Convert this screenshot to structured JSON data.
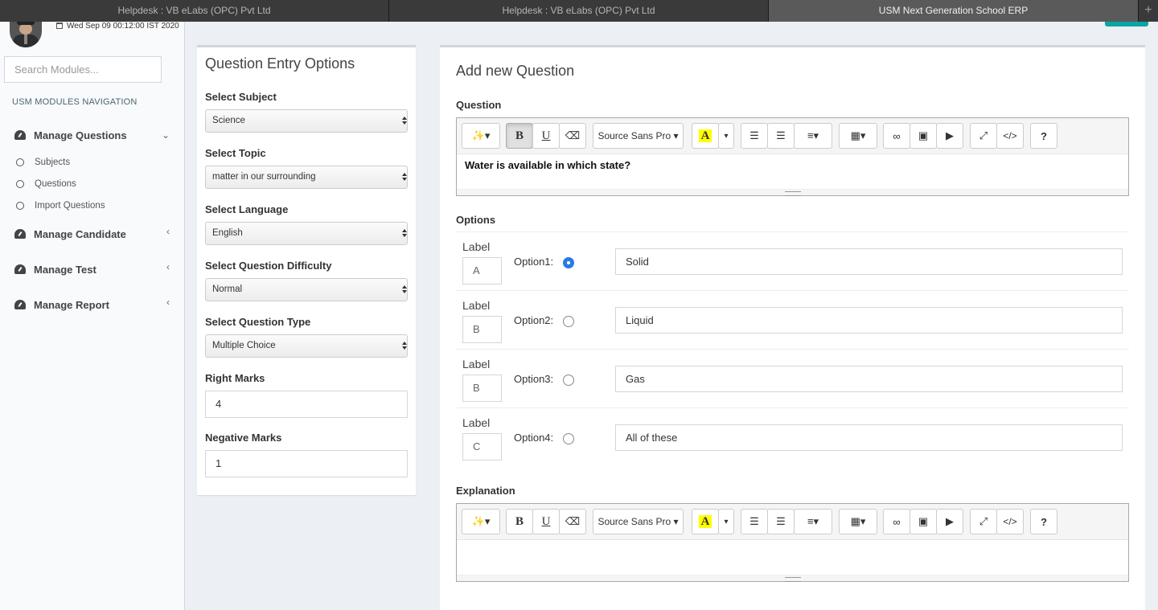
{
  "browser_tabs": [
    {
      "title": "Helpdesk : VB eLabs (OPC) Pvt Ltd",
      "active": false
    },
    {
      "title": "Helpdesk : VB eLabs (OPC) Pvt Ltd",
      "active": false
    },
    {
      "title": "USM Next Generation School ERP",
      "active": true
    }
  ],
  "new_tab_icon": "plus-icon",
  "user": {
    "date": "Wed Sep 09 00:12:00 IST 2020"
  },
  "sidebar": {
    "search_placeholder": "Search Modules...",
    "nav_header": "USM MODULES NAVIGATION",
    "menu": [
      {
        "label": "Manage Questions",
        "icon": "dashboard-icon",
        "expanded": true,
        "children": [
          "Subjects",
          "Questions",
          "Import Questions"
        ]
      },
      {
        "label": "Manage Candidate",
        "icon": "dashboard-icon",
        "expanded": false
      },
      {
        "label": "Manage Test",
        "icon": "dashboard-icon",
        "expanded": false
      },
      {
        "label": "Manage Report",
        "icon": "dashboard-icon",
        "expanded": false
      }
    ]
  },
  "entry_options": {
    "title": "Question Entry Options",
    "subject": {
      "label": "Select Subject",
      "value": "Science"
    },
    "topic": {
      "label": "Select Topic",
      "value": "matter in our surrounding"
    },
    "language": {
      "label": "Select Language",
      "value": "English"
    },
    "difficulty": {
      "label": "Select Question Difficulty",
      "value": "Normal"
    },
    "type": {
      "label": "Select Question Type",
      "value": "Multiple Choice"
    },
    "right_marks": {
      "label": "Right Marks",
      "value": "4"
    },
    "negative_marks": {
      "label": "Negative Marks",
      "value": "1"
    }
  },
  "question_form": {
    "title": "Add new Question",
    "question_label": "Question",
    "question_text": "Water is available in which state?",
    "options_label": "Options",
    "explanation_label": "Explanation",
    "editor_font": "Source Sans Pro",
    "options": [
      {
        "label_caption": "Label",
        "label": "A",
        "name": "Option1:",
        "value": "Solid",
        "selected": true
      },
      {
        "label_caption": "Label",
        "label": "B",
        "name": "Option2:",
        "value": "Liquid",
        "selected": false
      },
      {
        "label_caption": "Label",
        "label": "B",
        "name": "Option3:",
        "value": "Gas",
        "selected": false
      },
      {
        "label_caption": "Label",
        "label": "C",
        "name": "Option4:",
        "value": "All of these",
        "selected": false
      }
    ]
  },
  "toolbar_glyphs": {
    "bold": "B",
    "underline": "U",
    "highlight": "A",
    "code": "</>",
    "help": "?"
  },
  "colors": {
    "accent": "#2a7ae2",
    "teal_button": "#0aa5a4",
    "sidebar_bg": "#f9fafc",
    "content_bg": "#ecf0f5"
  }
}
